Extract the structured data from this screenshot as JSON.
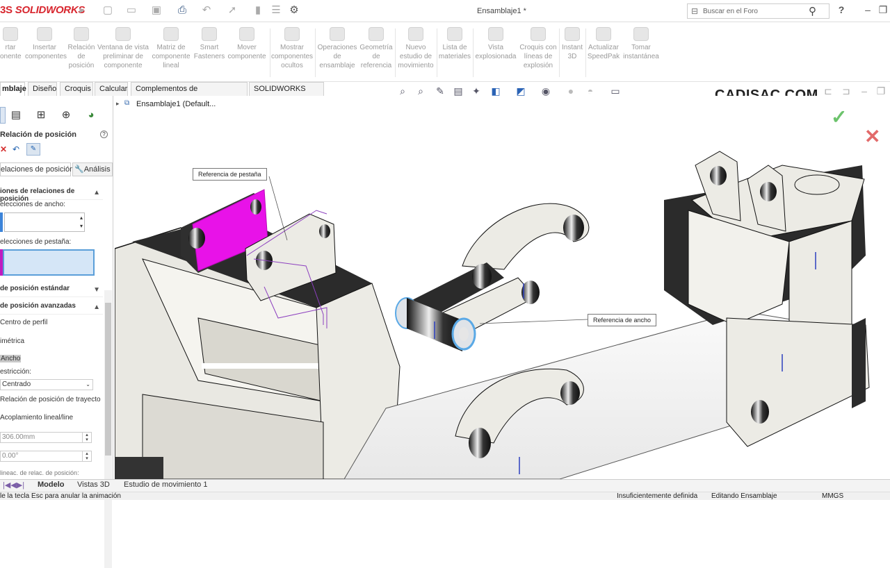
{
  "app": {
    "brand_ds": "3S",
    "brand_name": "SOLIDWORKS",
    "doc_title": "Ensamblaje1 *"
  },
  "search": {
    "placeholder": "Buscar en el Foro"
  },
  "ribbon": [
    {
      "label": "rtar\nonente"
    },
    {
      "label": "Insertar\ncomponentes"
    },
    {
      "label": "Relación\nde\nposición"
    },
    {
      "label": "Ventana de vista\npreliminar de\ncomponente"
    },
    {
      "label": "Matriz de\ncomponente\nlineal"
    },
    {
      "label": "Smart\nFasteners"
    },
    {
      "label": "Mover\ncomponente"
    },
    {
      "label": "Mostrar\ncomponentes\nocultos"
    },
    {
      "label": "Operaciones\nde\nensamblaje"
    },
    {
      "label": "Geometría\nde\nreferencia"
    },
    {
      "label": "Nuevo\nestudio de\nmovimiento"
    },
    {
      "label": "Lista de\nmateriales"
    },
    {
      "label": "Vista\nexplosionada"
    },
    {
      "label": "Croquis con\nlíneas de\nexplosión"
    },
    {
      "label": "Instant\n3D"
    },
    {
      "label": "Actualizar\nSpeedPak"
    },
    {
      "label": "Tomar\ninstantánea"
    }
  ],
  "tabs": [
    "mblaje",
    "Diseño",
    "Croquis",
    "Calcular",
    "Complementos de SOLIDWORKS",
    "SOLIDWORKS MBD"
  ],
  "brand_watermark": "CADISAC.COM",
  "tree": {
    "root": "Ensamblaje1  (Default..."
  },
  "panel": {
    "title": "Relación de posición",
    "help": "?",
    "tab_mates": "elaciones de posición",
    "tab_analysis": "Análisis",
    "section_selections": "iones de relaciones de posición",
    "width_label": "elecciones de ancho:",
    "tab_label": "elecciones de pestaña:",
    "standard_section": "de posición estándar",
    "advanced_section": "de posición avanzadas",
    "opt_profile": "Centro de perfil",
    "opt_symmetric": "imétrica",
    "opt_width": "Ancho",
    "restriction_label": "estricción:",
    "restriction_value": "Centrado",
    "opt_path": "Relación de posición de trayecto",
    "opt_linear": "Acoplamiento lineal/line",
    "distance_value": "306.00mm",
    "angle_value": "0.00°",
    "bottom_text": "lineac. de relac. de posición:"
  },
  "callouts": {
    "tab_ref": "Referencia de pestaña",
    "width_ref": "Referencia de ancho"
  },
  "bottom_tabs": [
    "Modelo",
    "Vistas 3D",
    "Estudio de movimiento 1"
  ],
  "status": {
    "left": "le la tecla Esc para anular la animación",
    "defined": "Insuficientemente definida",
    "mode": "Editando Ensamblaje",
    "units": "MMGS"
  },
  "colors": {
    "brand_red": "#d8262e",
    "highlight_magenta": "#e812e8",
    "accept_green": "#6cc36c",
    "cancel_red": "#e26a6a"
  }
}
